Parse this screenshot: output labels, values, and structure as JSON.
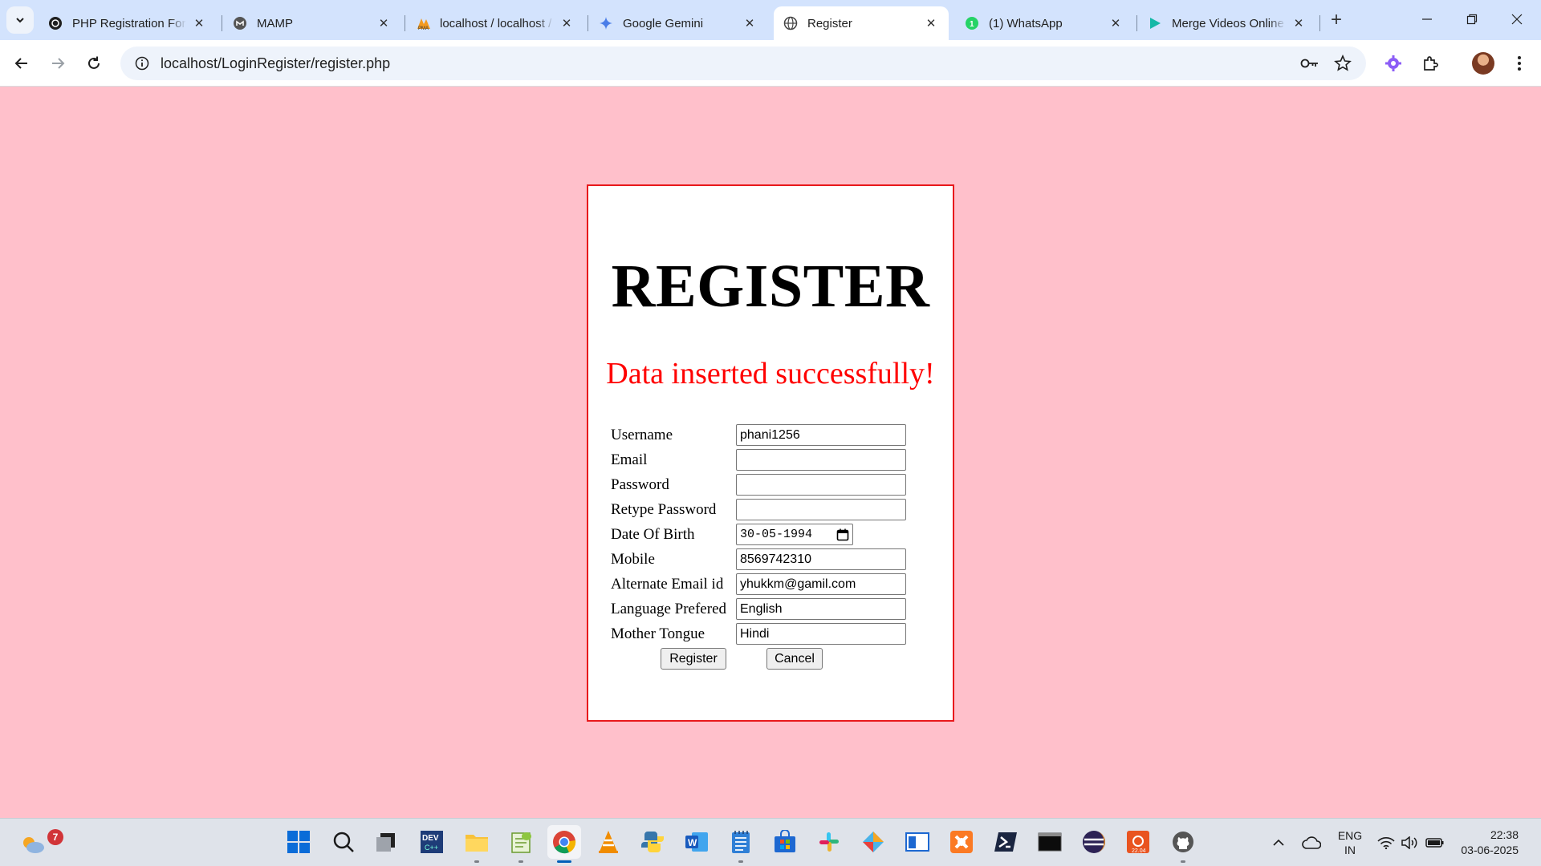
{
  "browser": {
    "tabs": [
      {
        "title": "PHP Registration Form",
        "icon": "openai-icon"
      },
      {
        "title": "MAMP",
        "icon": "mamp-icon"
      },
      {
        "title": "localhost / localhost / phpMyAdmin",
        "icon": "phpmyadmin-icon"
      },
      {
        "title": "Google Gemini",
        "icon": "gemini-icon"
      },
      {
        "title": "Register",
        "icon": "globe-icon",
        "active": true
      },
      {
        "title": "(1) WhatsApp",
        "icon": "whatsapp-icon"
      },
      {
        "title": "Merge Videos Online",
        "icon": "play-icon"
      }
    ],
    "url": "localhost/LoginRegister/register.php"
  },
  "page": {
    "heading": "REGISTER",
    "message": "Data inserted successfully!",
    "message_color": "#ff0000",
    "background": "#ffc0cb",
    "border_color": "#e8191c",
    "fields": [
      {
        "label": "Username",
        "value": "phani1256"
      },
      {
        "label": "Email",
        "value": ""
      },
      {
        "label": "Password",
        "value": ""
      },
      {
        "label": "Retype Password",
        "value": ""
      },
      {
        "label": "Date Of Birth",
        "value": "30-05-1994"
      },
      {
        "label": "Mobile",
        "value": "8569742310"
      },
      {
        "label": "Alternate Email id",
        "value": "yhukkm@gamil.com"
      },
      {
        "label": "Language Prefered",
        "value": "English"
      },
      {
        "label": "Mother Tongue",
        "value": "Hindi"
      }
    ],
    "register_label": "Register",
    "cancel_label": "Cancel"
  },
  "taskbar": {
    "weather_badge": "7",
    "lang_line1": "ENG",
    "lang_line2": "IN",
    "time": "22:38",
    "date": "03-06-2025"
  }
}
